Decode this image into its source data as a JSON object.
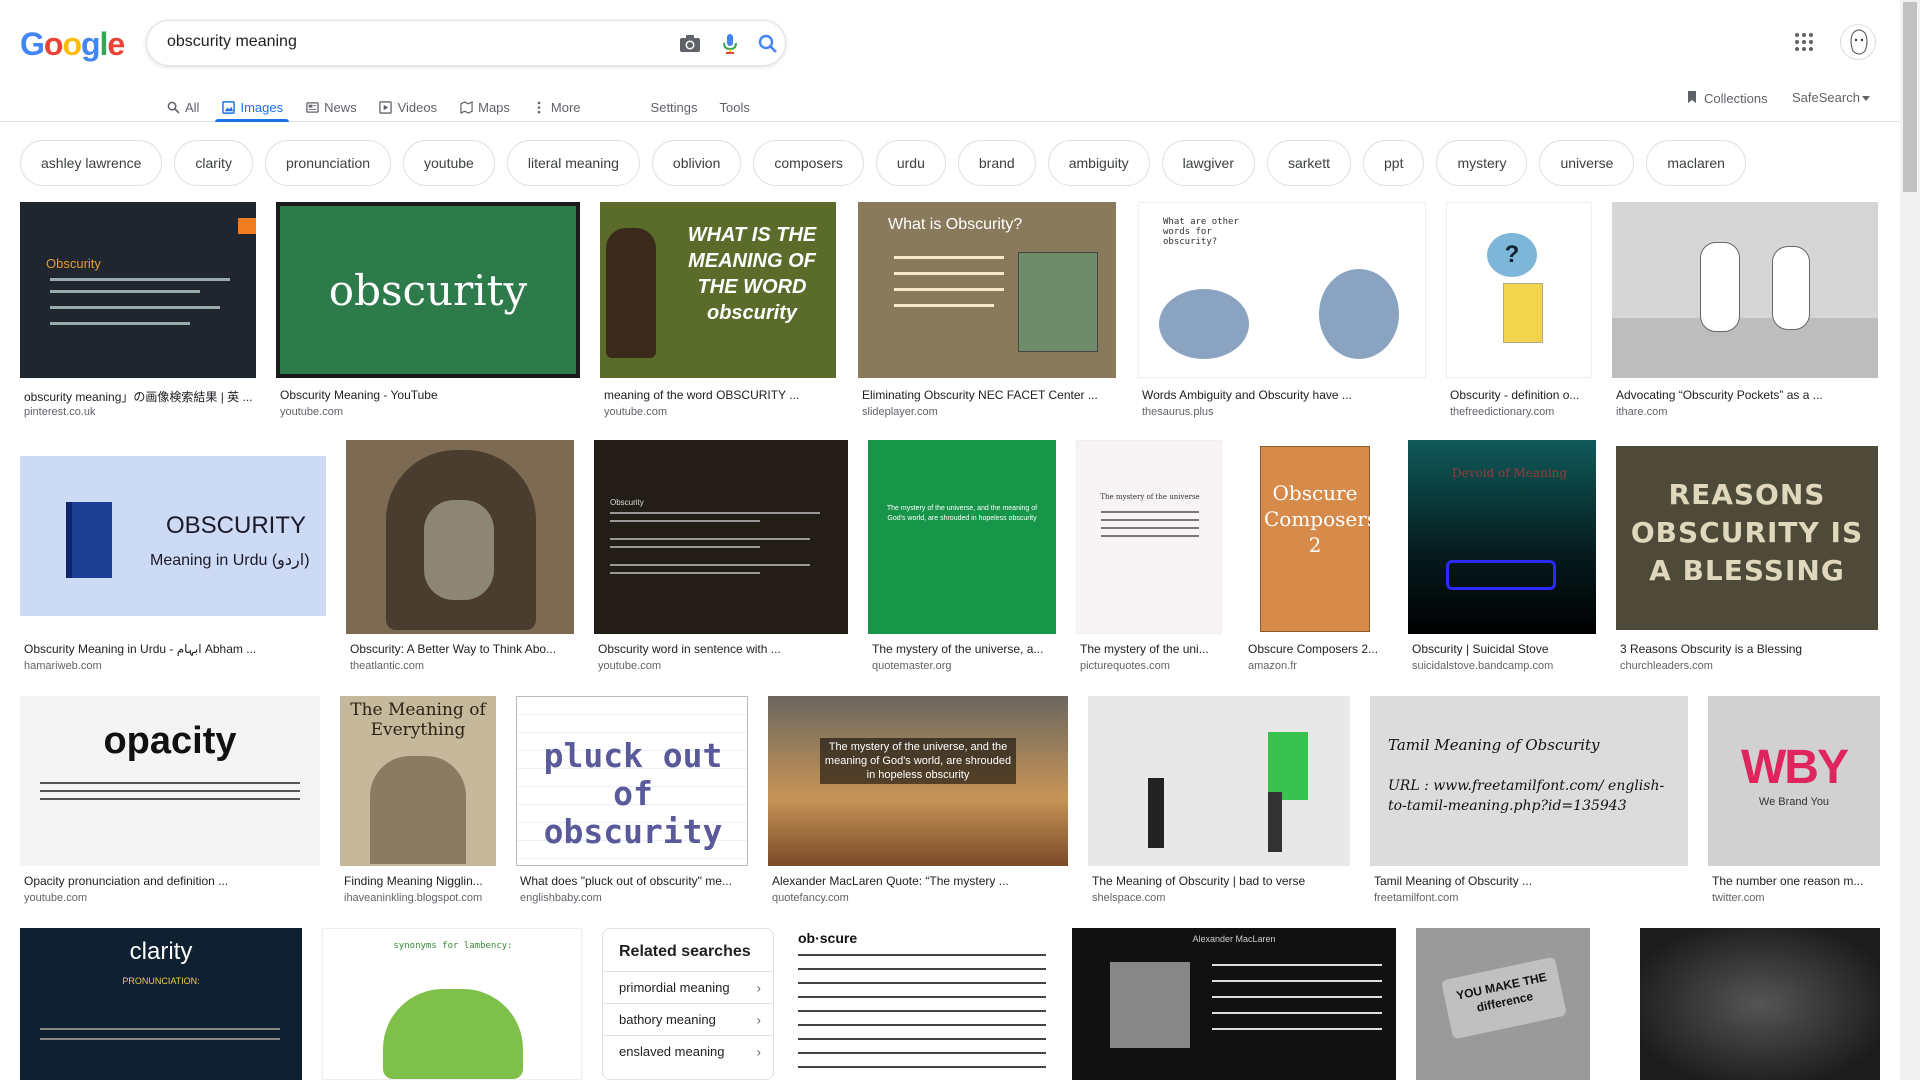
{
  "logo_text": [
    "G",
    "o",
    "o",
    "g",
    "l",
    "e"
  ],
  "logo_colors": [
    "#4285F4",
    "#EA4335",
    "#FBBC05",
    "#4285F4",
    "#34A853",
    "#EA4335"
  ],
  "search": {
    "query": "obscurity meaning"
  },
  "icons": {
    "camera": "camera-icon",
    "mic": "microphone-icon",
    "search": "search-icon",
    "apps": "apps-grid-icon"
  },
  "tabs": [
    {
      "label": "All",
      "icon": "search-icon"
    },
    {
      "label": "Images",
      "icon": "image-icon"
    },
    {
      "label": "News",
      "icon": "news-icon"
    },
    {
      "label": "Videos",
      "icon": "video-icon"
    },
    {
      "label": "Maps",
      "icon": "map-icon"
    },
    {
      "label": "More",
      "icon": "more-vert-icon"
    }
  ],
  "tools": {
    "settings": "Settings",
    "tools": "Tools"
  },
  "collections": "Collections",
  "safesearch": "SafeSearch",
  "chips": [
    "ashley lawrence",
    "clarity",
    "pronunciation",
    "youtube",
    "literal meaning",
    "oblivion",
    "composers",
    "urdu",
    "brand",
    "ambiguity",
    "lawgiver",
    "sarkett",
    "ppt",
    "mystery",
    "universe",
    "maclaren"
  ],
  "results": [
    {
      "title": "obscurity meaning」の画像検索結果 | 英 ...",
      "source": "pinterest.co.uk",
      "text": "Obscurity"
    },
    {
      "title": "Obscurity Meaning - YouTube",
      "source": "youtube.com",
      "text": "obscurity"
    },
    {
      "title": "meaning of the word OBSCURITY ...",
      "source": "youtube.com",
      "text": "WHAT IS THE MEANING OF THE WORD obscurity"
    },
    {
      "title": "Eliminating Obscurity NEC FACET Center ...",
      "source": "slideplayer.com",
      "text": "What is Obscurity?"
    },
    {
      "title": "Words Ambiguity and Obscurity have ...",
      "source": "thesaurus.plus",
      "text": "What are other words for obscurity?"
    },
    {
      "title": "Obscurity - definition o...",
      "source": "thefreedictionary.com",
      "text": "?"
    },
    {
      "title": "Advocating “Obscurity Pockets” as a ...",
      "source": "ithare.com",
      "text": ""
    },
    {
      "title": "Obscurity Meaning in Urdu - ابہام Abham ...",
      "source": "hamariweb.com",
      "text": "OBSCURITY",
      "text2": "Meaning in Urdu (اردو)"
    },
    {
      "title": "Obscurity: A Better Way to Think Abo...",
      "source": "theatlantic.com",
      "text": ""
    },
    {
      "title": "Obscurity word in sentence with ...",
      "source": "youtube.com",
      "text": "Obscurity"
    },
    {
      "title": "The mystery of the universe, a...",
      "source": "quotemaster.org",
      "text": "The mystery of the universe, and the meaning of God's world, are shrouded in hopeless obscurity"
    },
    {
      "title": "The mystery of the uni...",
      "source": "picturequotes.com",
      "text": "The mystery of the universe"
    },
    {
      "title": "Obscure Composers 2...",
      "source": "amazon.fr",
      "text": "Obscure Composers 2"
    },
    {
      "title": "Obscurity | Suicidal Stove",
      "source": "suicidalstove.bandcamp.com",
      "text": "Devoid of Meaning"
    },
    {
      "title": "3 Reasons Obscurity is a Blessing",
      "source": "churchleaders.com",
      "text": "REASONS OBSCURITY IS A BLESSING"
    },
    {
      "title": "Opacity pronunciation and definition ...",
      "source": "youtube.com",
      "text": "opacity"
    },
    {
      "title": "Finding Meaning Nigglin...",
      "source": "ihaveaninkling.blogspot.com",
      "text": "The Meaning of Everything"
    },
    {
      "title": "What does \"pluck out of obscurity\" me...",
      "source": "englishbaby.com",
      "text": "pluck out of obscurity"
    },
    {
      "title": "Alexander MacLaren Quote: “The mystery ...",
      "source": "quotefancy.com",
      "text": "The mystery of the universe, and the meaning of God's world, are shrouded in hopeless obscurity"
    },
    {
      "title": "The Meaning of Obscurity | bad to verse",
      "source": "shelspace.com",
      "text": ""
    },
    {
      "title": "Tamil Meaning of Obscurity ...",
      "source": "freetamilfont.com",
      "text": "Tamil Meaning of Obscurity",
      "text2": "URL : www.freetamilfont.com/ english-to-tamil-meaning.php?id=135943"
    },
    {
      "title": "The number one reason m...",
      "source": "twitter.com",
      "text": "WBY",
      "text2": "We Brand You"
    },
    {
      "title": "",
      "source": "",
      "text": "clarity",
      "text2": "PRONUNCIATION:"
    },
    {
      "title": "",
      "source": "",
      "text": "synonyms for lambency:"
    },
    {
      "title": "",
      "source": "",
      "text": "ob·scure"
    },
    {
      "title": "",
      "source": "",
      "text": "Alexander MacLaren"
    },
    {
      "title": "",
      "source": "",
      "text": "YOU MAKE THE difference"
    },
    {
      "title": "",
      "source": "",
      "text": ""
    }
  ],
  "related": {
    "heading": "Related searches",
    "items": [
      "primordial meaning",
      "bathory meaning",
      "enslaved meaning"
    ]
  }
}
